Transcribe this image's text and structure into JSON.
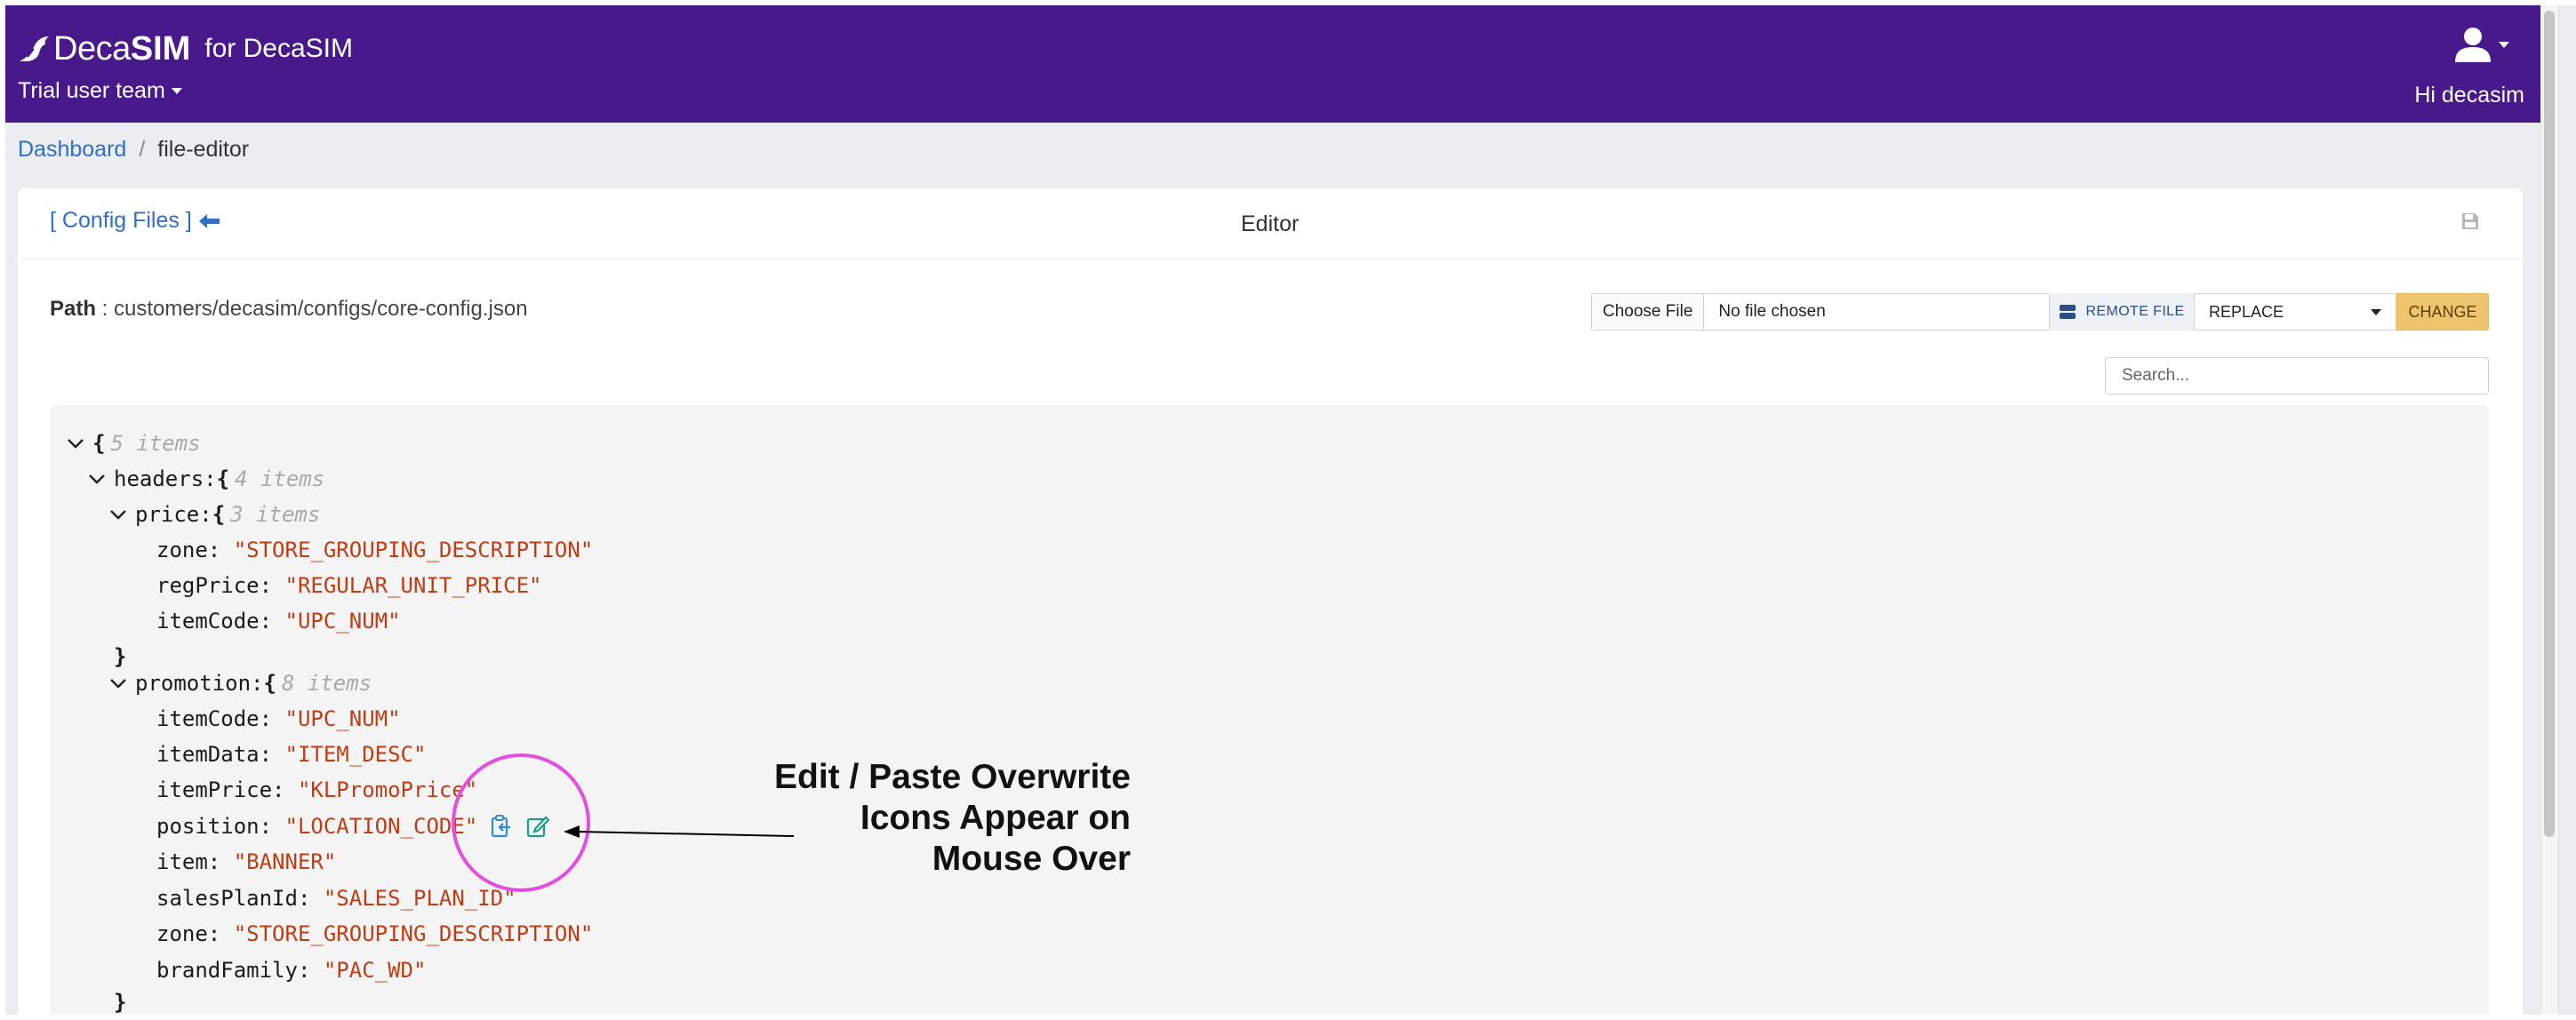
{
  "header": {
    "brand_deca": "Deca",
    "brand_sim": "SIM",
    "brand_for": "for DecaSIM",
    "team": "Trial user team",
    "greeting": "Hi decasim",
    "bg_color": "#48198a"
  },
  "breadcrumb": {
    "home": "Dashboard",
    "separator": "/",
    "current": "file-editor"
  },
  "card": {
    "back_link": "[ Config Files ]",
    "title": "Editor",
    "path_label": "Path",
    "path_value": " : customers/decasim/configs/core-config.json"
  },
  "file_controls": {
    "choose_file": "Choose File",
    "no_file": "No file chosen",
    "remote_file": "REMOTE FILE",
    "mode": "REPLACE",
    "change": "CHANGE"
  },
  "search": {
    "placeholder": "Search..."
  },
  "json_view": {
    "root_meta": "5 items",
    "headers_key": "headers:",
    "headers_meta": "4 items",
    "price_key": "price:",
    "price_meta": "3 items",
    "price_items": [
      {
        "key": "zone: ",
        "value": "\"STORE_GROUPING_DESCRIPTION\""
      },
      {
        "key": "regPrice: ",
        "value": "\"REGULAR_UNIT_PRICE\""
      },
      {
        "key": "itemCode: ",
        "value": "\"UPC_NUM\""
      }
    ],
    "promotion_key": "promotion:",
    "promotion_meta": "8 items",
    "promotion_items": [
      {
        "key": "itemCode: ",
        "value": "\"UPC_NUM\""
      },
      {
        "key": "itemData: ",
        "value": "\"ITEM_DESC\""
      },
      {
        "key": "itemPrice: ",
        "value": "\"KLPromoPrice\""
      },
      {
        "key": "position: ",
        "value": "\"LOCATION_CODE\""
      },
      {
        "key": "item: ",
        "value": "\"BANNER\""
      },
      {
        "key": "salesPlanId: ",
        "value": "\"SALES_PLAN_ID\""
      },
      {
        "key": "zone: ",
        "value": "\"STORE_GROUPING_DESCRIPTION\""
      },
      {
        "key": "brandFamily: ",
        "value": "\"PAC_WD\""
      }
    ],
    "hovered_row_icons": [
      "paste-icon",
      "edit-icon"
    ]
  },
  "annotation": {
    "line1": "Edit / Paste  Overwrite",
    "line2": "Icons Appear on",
    "line3": "Mouse  Over",
    "circle_color": "#e24fde"
  }
}
